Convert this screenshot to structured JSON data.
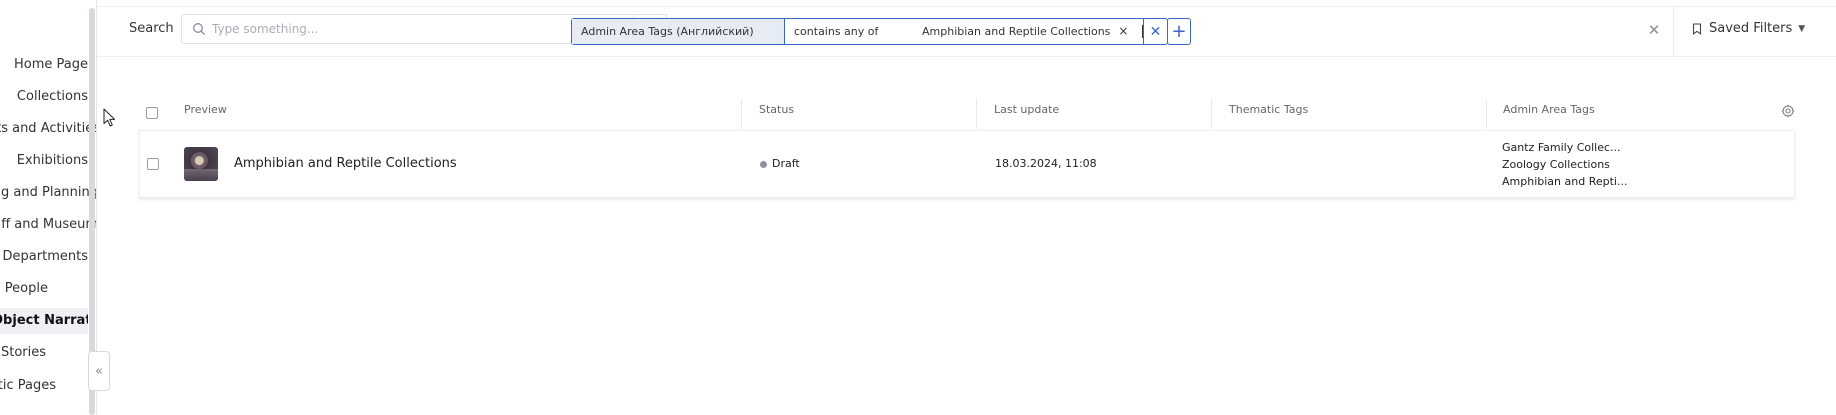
{
  "sidebar": {
    "items": [
      {
        "label": "Home Page",
        "active": false
      },
      {
        "label": "Collections",
        "active": false
      },
      {
        "label": "Events and Activities",
        "active": false
      },
      {
        "label": "Exhibitions",
        "active": false
      },
      {
        "label": "Meeting and Planning",
        "active": false
      },
      {
        "label": "Staff and Museum",
        "active": false
      },
      {
        "label": "Departments",
        "active": false
      },
      {
        "label": "People",
        "active": false
      },
      {
        "label": "Object Narratives",
        "active": true
      },
      {
        "label": "Stories",
        "active": false
      },
      {
        "label": "Static Pages",
        "active": false
      }
    ],
    "collapse_glyph": "«"
  },
  "search": {
    "label": "Search",
    "placeholder": "Type something..."
  },
  "filter": {
    "field": "Admin Area Tags (Английский)",
    "operator": "contains any of",
    "value": "Amphibian and Reptile Collections",
    "tag_remove": "×",
    "clear": "✕",
    "add": "+"
  },
  "toolbar": {
    "clear_all": "✕",
    "saved_filters": "Saved Filters"
  },
  "table": {
    "columns": [
      "Preview",
      "Status",
      "Last update",
      "Thematic Tags",
      "Admin Area Tags"
    ],
    "rows": [
      {
        "title": "Amphibian and Reptile Collections",
        "status": "Draft",
        "last_update": "18.03.2024, 11:08",
        "thematic_tags": "",
        "admin_tags": [
          "Gantz Family Collec...",
          "Zoology Collections",
          "Amphibian and Repti..."
        ]
      }
    ]
  },
  "colors": {
    "accent": "#3a66c4",
    "chip_field_bg": "#e7ebf3",
    "active_sidebar_bg": "#eef0f3",
    "status_draft": "#8d9199"
  }
}
